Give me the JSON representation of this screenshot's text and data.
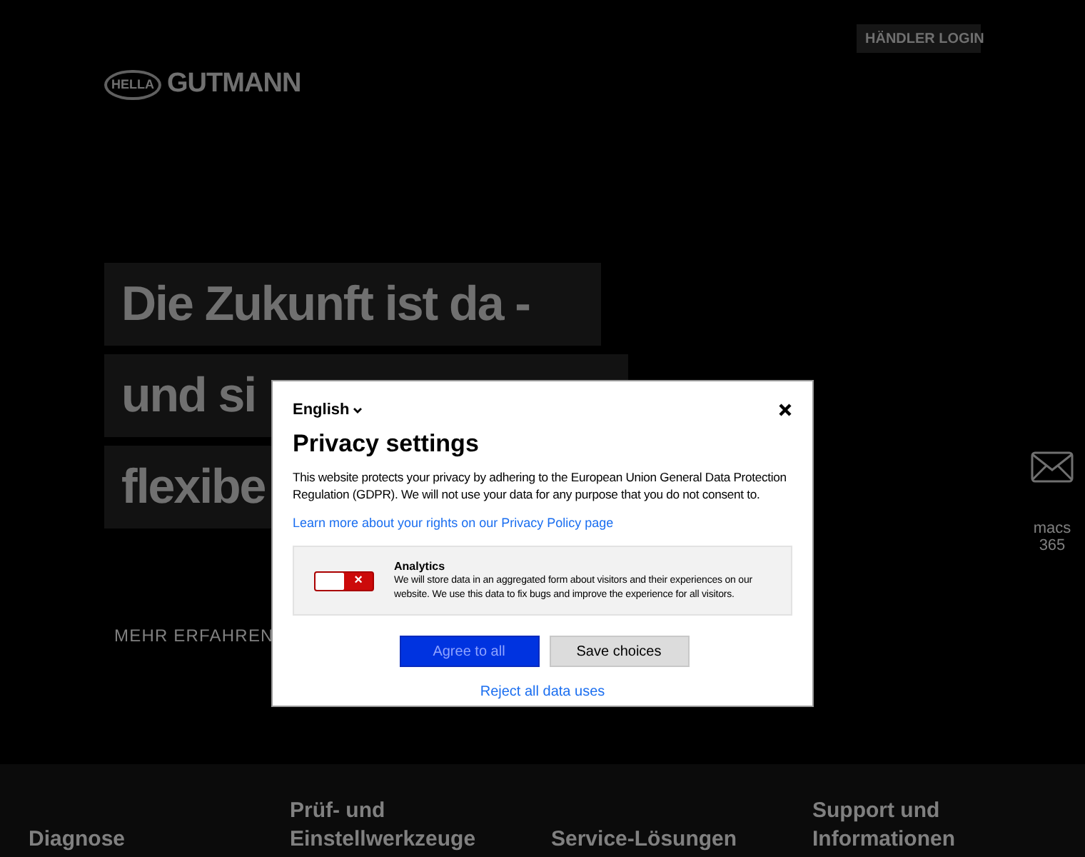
{
  "header": {
    "logo": {
      "badge": "HELLA",
      "wordmark": "GUTMANN"
    },
    "login_button": "HÄNDLER LOGIN"
  },
  "hero": {
    "lines": [
      "Die Zukunft ist da -",
      "und si",
      "flexibe"
    ],
    "link": "MEHR ERFAHREN"
  },
  "side_contact": {
    "lines": [
      "macs",
      "365"
    ]
  },
  "footer_categories": [
    {
      "label": "Diagnose"
    },
    {
      "label": "Prüf- und Einstellwerkzeuge"
    },
    {
      "label": "Service-Lösungen"
    },
    {
      "label": "Support und Informationen"
    }
  ],
  "privacy_dialog": {
    "language": "English",
    "title": "Privacy settings",
    "text": "This website protects your privacy by adhering to the European Union General Data Protection Regulation (GDPR). We will not use your data for any purpose that you do not consent to.",
    "policy_link": "Learn more about your rights on our Privacy Policy page",
    "options": [
      {
        "title": "Analytics",
        "description": "We will store data in an aggregated form about visitors and their experiences on our website. We use this data to fix bugs and improve the experience for all visitors.",
        "on": false,
        "off_mark": "×"
      }
    ],
    "buttons": [
      {
        "label": "Agree to all",
        "kind": "primary"
      },
      {
        "label": "Save choices",
        "kind": "secondary"
      }
    ],
    "reject_link": "Reject all data uses"
  }
}
